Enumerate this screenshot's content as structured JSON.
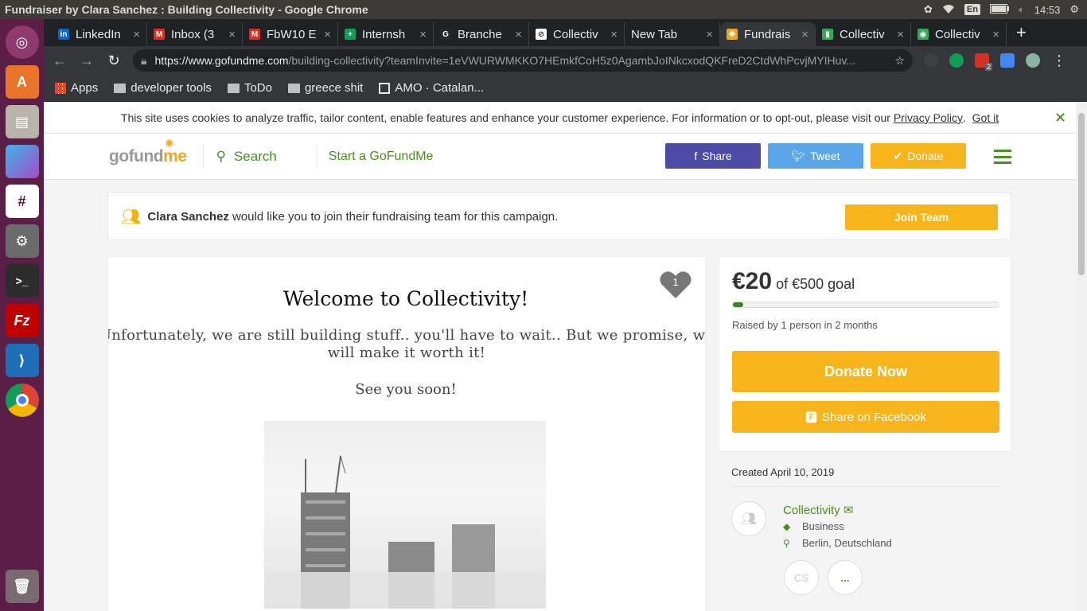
{
  "os": {
    "window_title": "Fundraiser by Clara Sanchez : Building Collectivity - Google Chrome",
    "keyboard_layout": "En",
    "time": "14:53"
  },
  "browser": {
    "tabs": [
      {
        "label": "LinkedIn",
        "color": "#0a66c2",
        "glyph": "in"
      },
      {
        "label": "Inbox (3",
        "color": "#d93025",
        "glyph": "M"
      },
      {
        "label": "FbW10 E",
        "color": "#d93025",
        "glyph": "M"
      },
      {
        "label": "Internsh",
        "color": "#0f9d58",
        "glyph": "+"
      },
      {
        "label": "Branche",
        "color": "#24292e",
        "glyph": "G"
      },
      {
        "label": "Collectiv",
        "color": "#ffffff",
        "glyph": "⊘"
      },
      {
        "label": "New Tab",
        "color": "",
        "glyph": ""
      },
      {
        "label": "Fundrais",
        "color": "#e9a824",
        "glyph": "✺"
      },
      {
        "label": "Collectiv",
        "color": "#34a853",
        "glyph": "▮"
      },
      {
        "label": "Collectiv",
        "color": "#34a853",
        "glyph": "◉"
      }
    ],
    "active_tab": 7,
    "url_domain": "https://www.gofundme.com",
    "url_path": "/building-collectivity?teamInvite=1eVWURWMKKO7HEmkfCoH5z0AgambJoINkcxodQKFreD2CtdWhPcvjMYIHuv...",
    "bookmarks": [
      "Apps",
      "developer tools",
      "ToDo",
      "greece shit",
      "AMO · Catalan..."
    ],
    "extension_badge": "2"
  },
  "cookie": {
    "text": "This site uses cookies to analyze traffic, tailor content, enable features and enhance your customer experience. For information or to opt-out, please visit our",
    "link": "Privacy Policy",
    "dot": ".",
    "got_it": "Got it",
    "close": "✕"
  },
  "header": {
    "logo_a": "go",
    "logo_b": "fund",
    "logo_c": "me",
    "search": "Search",
    "start": "Start a GoFundMe",
    "share": "Share",
    "tweet": "Tweet",
    "donate": "Donate"
  },
  "team": {
    "name": "Clara Sanchez",
    "message": "would like you to join their fundraising team for this campaign.",
    "join": "Join Team"
  },
  "story": {
    "heart_count": "1",
    "title": "Welcome to Collectivity!",
    "line1": "Unfortunately, we are still building stuff.. you'll have to wait.. But we promise, we will make it worth it!",
    "line2": "See you soon!"
  },
  "campaign": {
    "raised": "€20",
    "goal_text": "of €500 goal",
    "progress_fraction": 0.04,
    "raised_by": "Raised by 1 person in 2 months",
    "donate_now": "Donate Now",
    "share_fb": "Share on Facebook",
    "created": "Created April 10, 2019",
    "organizer": "Collectivity",
    "category": "Business",
    "location": "Berlin, Deutschland",
    "initials": "CS",
    "more": "..."
  },
  "colors": {
    "facebook": "#4c4ca6",
    "twitter": "#5aa5e8",
    "yellow": "#f7b51b",
    "green": "#4a8f1c"
  }
}
